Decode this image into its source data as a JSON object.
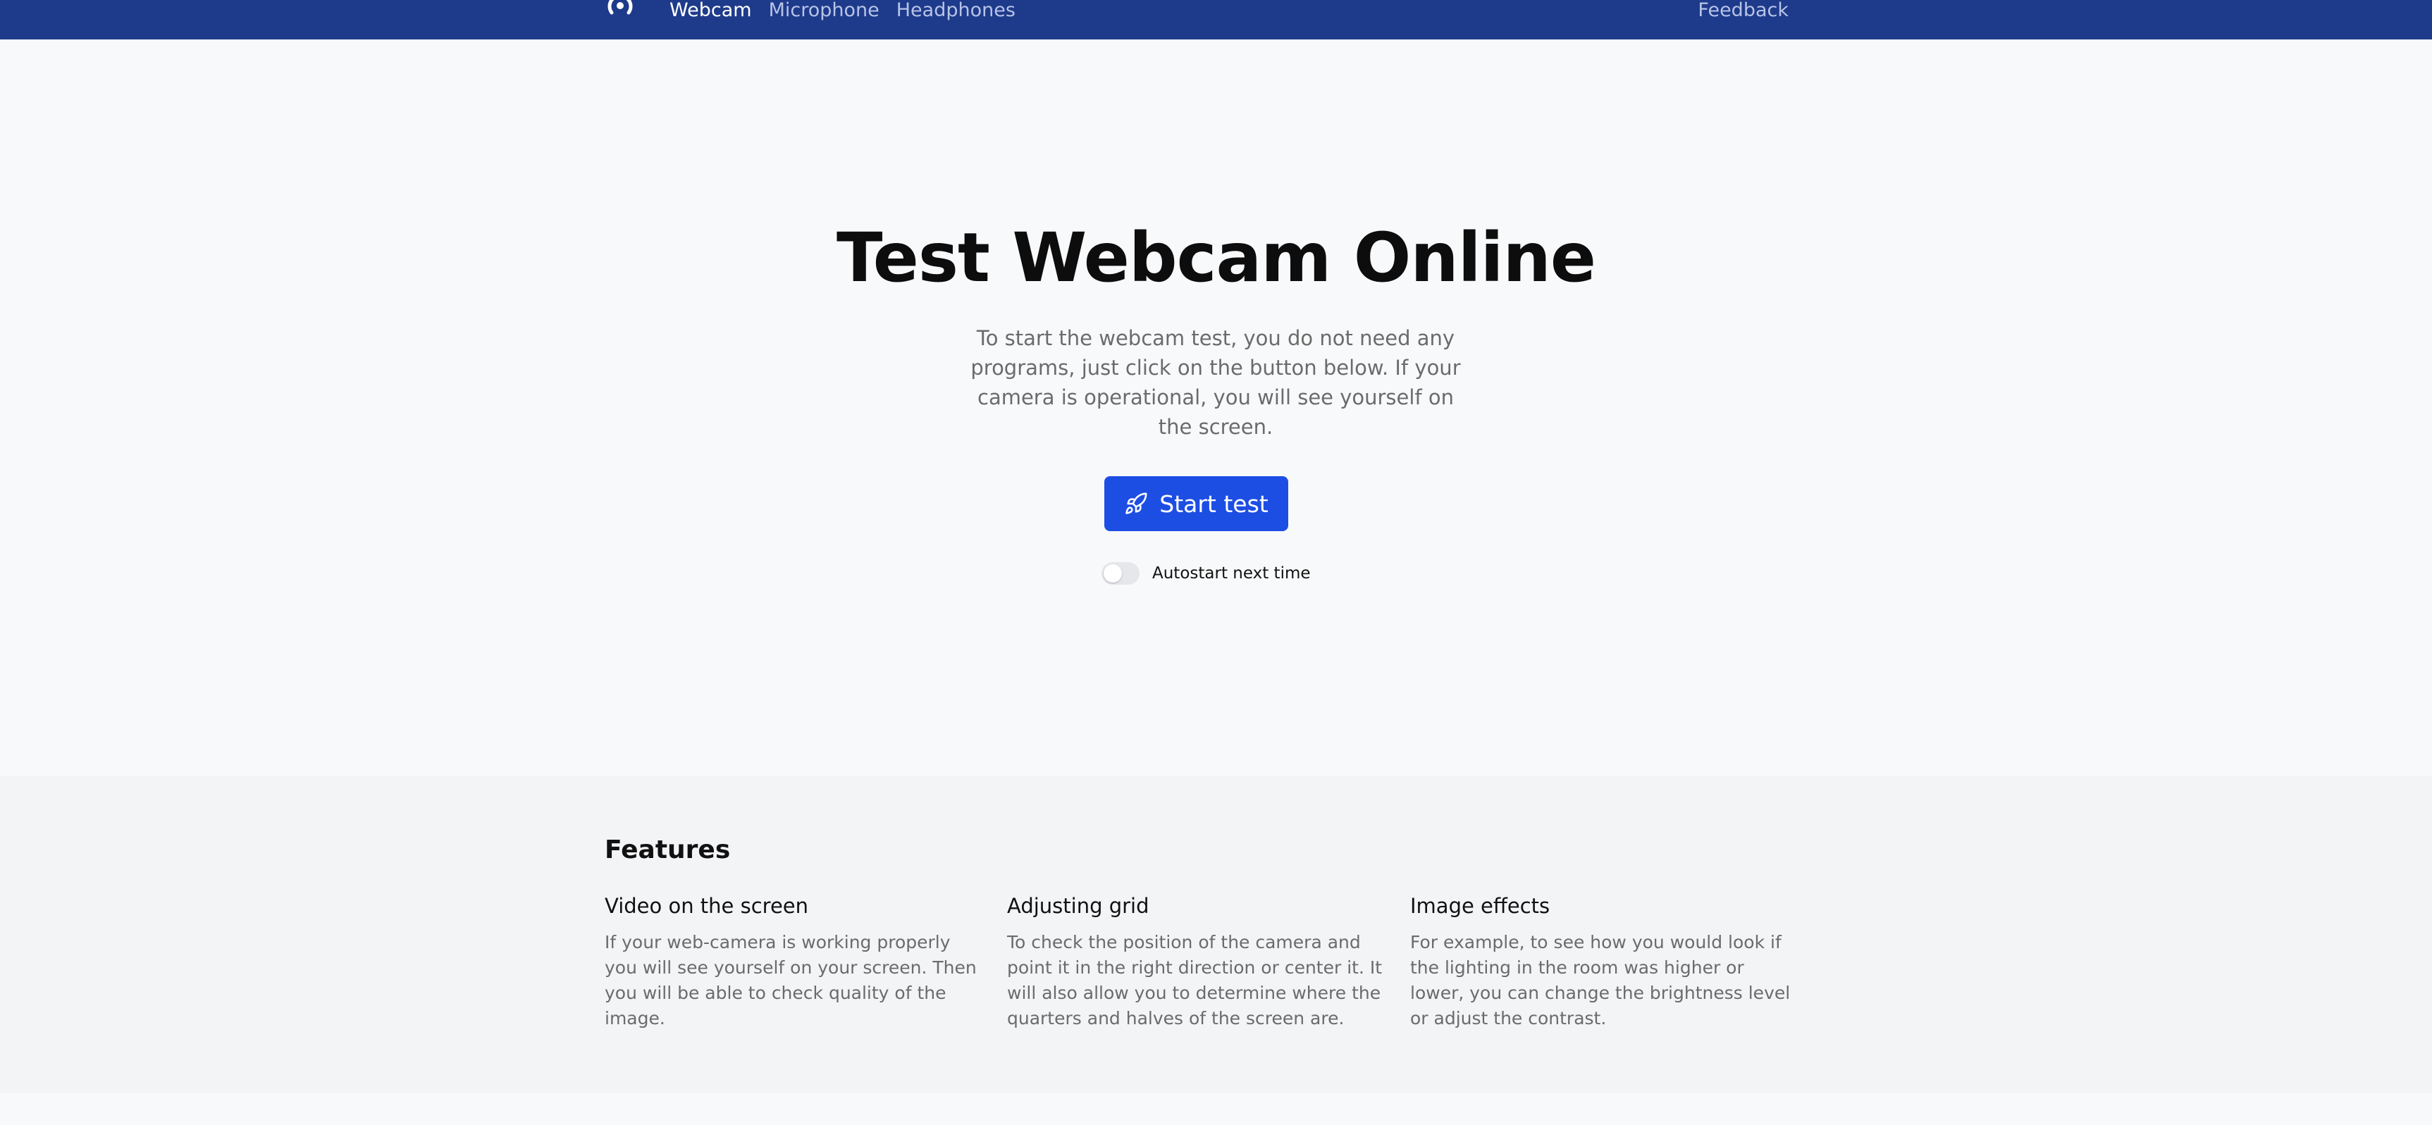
{
  "nav": {
    "logo_icon": "broadcast-icon",
    "links": [
      {
        "label": "Webcam",
        "active": true
      },
      {
        "label": "Microphone",
        "active": false
      },
      {
        "label": "Headphones",
        "active": false
      }
    ],
    "feedback": "Feedback"
  },
  "hero": {
    "title": "Test Webcam Online",
    "description": "To start the webcam test, you do not need any programs, just click on the button below. If your camera is operational, you will see yourself on the screen.",
    "start_button": "Start test",
    "start_icon": "rocket-icon",
    "autostart_label": "Autostart next time",
    "autostart_on": false
  },
  "features": {
    "title": "Features",
    "items": [
      {
        "title": "Video on the screen",
        "text": "If your web-camera is working properly you will see yourself on your screen. Then you will be able to check quality of the image."
      },
      {
        "title": "Adjusting grid",
        "text": "To check the position of the camera and point it in the right direction or center it. It will also allow you to determine where the quarters and halves of the screen are."
      },
      {
        "title": "Image effects",
        "text": "For example, to see how you would look if the lighting in the room was higher or lower, you can change the brightness level or adjust the contrast."
      }
    ]
  },
  "colors": {
    "navbar": "#1e3a8a",
    "primary_button": "#1d4ee4",
    "page_bg": "#f8f9fb",
    "features_bg": "#f3f4f6"
  }
}
